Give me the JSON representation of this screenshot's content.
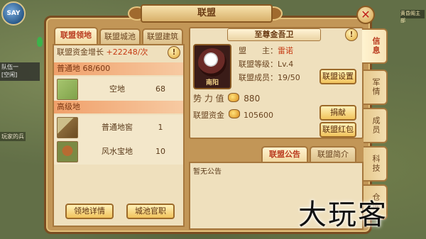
{
  "map": {
    "logo_text": "SAY",
    "squad_name": "队伍一",
    "squad_status": "[空闲]",
    "map_label": "玩家的兵",
    "hud_text": "黄昏阁主部"
  },
  "window": {
    "title": "联盟",
    "close_symbol": "✕"
  },
  "tabs": [
    {
      "label": "联盟领地",
      "active": true
    },
    {
      "label": "联盟城池",
      "active": false
    },
    {
      "label": "联盟建筑",
      "active": false
    }
  ],
  "territory": {
    "growth_label": "联盟资金增长",
    "growth_value": "+22248/次",
    "normal_header": "普通地 68/600",
    "advanced_header": "高级地",
    "rows": [
      {
        "name": "空地",
        "count": "68",
        "icon": "grass-tile-icon"
      },
      {
        "name": "普通地窖",
        "count": "1",
        "icon": "cellar-icon"
      },
      {
        "name": "风水宝地",
        "count": "10",
        "icon": "fengshui-icon"
      }
    ],
    "btn_details": "领地详情",
    "btn_officials": "城池官职"
  },
  "alliance": {
    "name": "至尊金吾卫",
    "emblem_city": "南阳",
    "leader_label": "盟　　主：",
    "leader_value": "雷诺",
    "level_label": "联盟等级：",
    "level_value": "Lv.4",
    "members_label": "联盟成员：",
    "members_value": "19/50",
    "btn_settings": "联盟设置",
    "power_label": "势 力 值",
    "power_value": "880",
    "funds_label": "联盟资金",
    "funds_value": "105600",
    "btn_donate": "捐献",
    "btn_redpacket": "联盟红包"
  },
  "notice": {
    "tab_notice": "联盟公告",
    "tab_intro": "联盟简介",
    "text": "暂无公告"
  },
  "side_tabs": [
    {
      "label": "信息",
      "active": true
    },
    {
      "label": "军情",
      "active": false
    },
    {
      "label": "成员",
      "active": false
    },
    {
      "label": "科技",
      "active": false
    },
    {
      "label": "仓库",
      "active": false
    }
  ],
  "watermark": "大玩客",
  "colors": {
    "accent_red": "#c63b14",
    "frame_brown": "#7a4d21",
    "panel_bg": "#efe0bd"
  }
}
